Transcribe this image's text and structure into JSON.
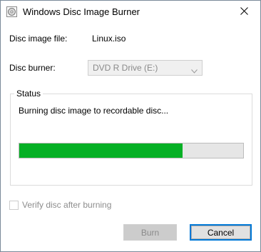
{
  "window": {
    "title": "Windows Disc Image Burner",
    "icon": "disc-burner-icon",
    "close_icon": "close-icon"
  },
  "fields": {
    "image_label": "Disc image file:",
    "image_value": "Linux.iso",
    "burner_label": "Disc burner:",
    "burner_selected": "DVD R Drive (E:)"
  },
  "status": {
    "group_title": "Status",
    "message": "Burning disc image to recordable disc...",
    "progress_fraction": 0.73,
    "progress_color": "#06b025"
  },
  "options": {
    "verify_label": "Verify disc after burning",
    "verify_checked": false
  },
  "buttons": {
    "burn_label": "Burn",
    "cancel_label": "Cancel"
  },
  "colors": {
    "accent": "#0078d7",
    "disabled_text": "#8a8a8a"
  }
}
